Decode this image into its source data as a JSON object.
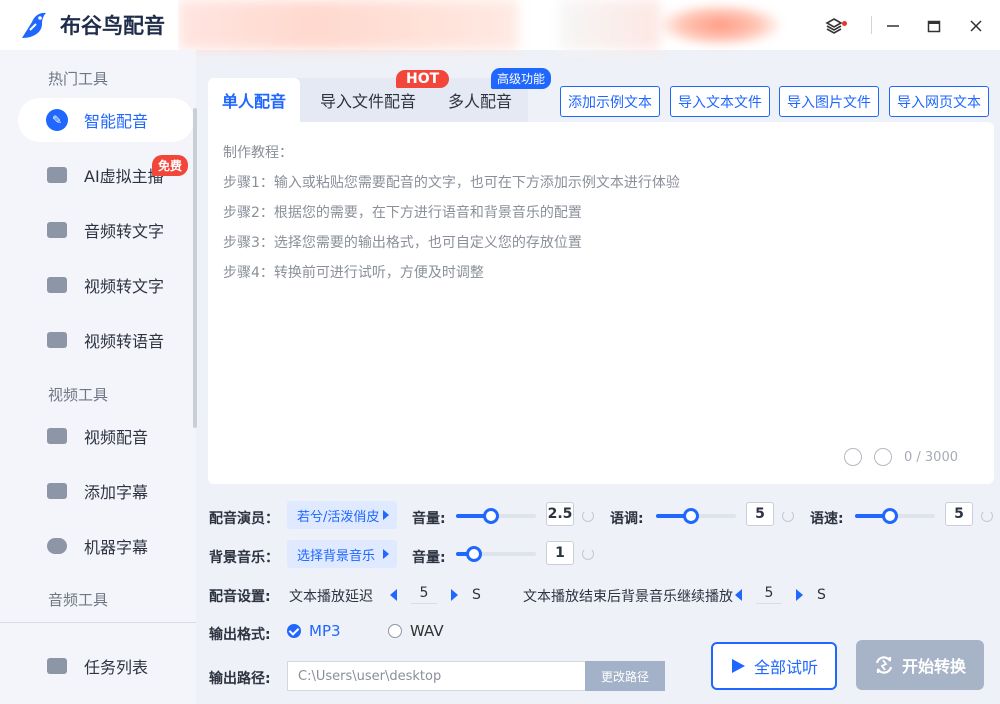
{
  "app": {
    "title": "布谷鸟配音"
  },
  "sidebar": {
    "sections": [
      "热门工具",
      "视频工具",
      "音频工具"
    ],
    "items": [
      {
        "label": "智能配音"
      },
      {
        "label": "AI虚拟主播"
      },
      {
        "label": "音频转文字"
      },
      {
        "label": "视频转文字"
      },
      {
        "label": "视频转语音"
      },
      {
        "label": "视频配音"
      },
      {
        "label": "添加字幕"
      },
      {
        "label": "机器字幕"
      },
      {
        "label": "任务列表"
      }
    ],
    "free_badge": "免费"
  },
  "tabs": [
    {
      "label": "单人配音"
    },
    {
      "label": "导入文件配音"
    },
    {
      "label": "多人配音"
    }
  ],
  "badges": {
    "hot": "HOT",
    "advanced": "高级功能"
  },
  "toolbar": {
    "add_sample": "添加示例文本",
    "import_text": "导入文本文件",
    "import_image": "导入图片文件",
    "import_web": "导入网页文本"
  },
  "editor": {
    "hints": [
      "制作教程：",
      "步骤1：输入或粘贴您需要配音的文字，也可在下方添加示例文本进行体验",
      "步骤2：根据您的需要，在下方进行语音和背景音乐的配置",
      "步骤3：选择您需要的输出格式，也可自定义您的存放位置",
      "步骤4：转换前可进行试听，方便及时调整"
    ],
    "counter": "0 / 3000"
  },
  "settings": {
    "voice_label": "配音演员：",
    "voice_value": "若兮/活泼俏皮",
    "volume_label": "音量:",
    "volume_value": "2.5",
    "pitch_label": "语调:",
    "pitch_value": "5",
    "speed_label": "语速:",
    "speed_value": "5",
    "bgm_label": "背景音乐：",
    "bgm_value": "选择背景音乐",
    "bgm_volume_label": "音量:",
    "bgm_volume_value": "1",
    "config_label": "配音设置:",
    "delay_label": "文本播放延迟",
    "delay_value": "5",
    "delay_unit": "S",
    "bgm_continue_label": "文本播放结束后背景音乐继续播放",
    "bgm_continue_value": "5",
    "bgm_continue_unit": "S",
    "format_label": "输出格式:",
    "format_mp3": "MP3",
    "format_wav": "WAV",
    "path_label": "输出路径:",
    "path_value": "C:\\Users\\user\\desktop",
    "change_path": "更改路径"
  },
  "actions": {
    "preview": "全部试听",
    "start": "开始转换"
  },
  "colors": {
    "accent": "#1f67ff",
    "hot": "#f2463a",
    "disabled": "#a7b3c6"
  }
}
